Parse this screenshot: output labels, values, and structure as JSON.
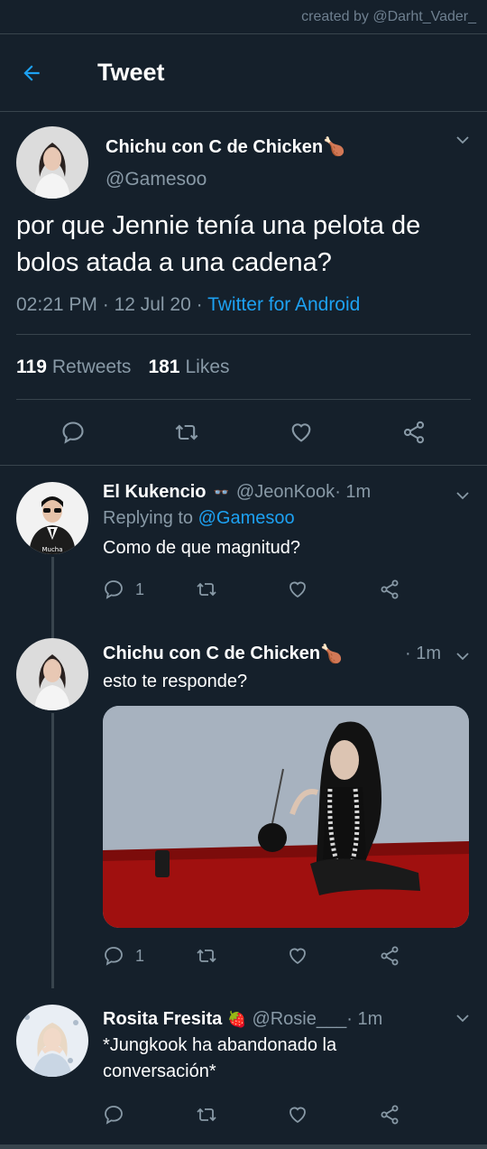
{
  "watermark": "created by @Darht_Vader_",
  "header": {
    "title": "Tweet"
  },
  "tweet": {
    "author_name": "Chichu con C de Chicken",
    "author_emoji": "🍗",
    "author_handle": "@Gamesoo",
    "text": "por que Jennie tenía una pelota de bolos atada a una cadena?",
    "time": "02:21 PM",
    "sep1": " · ",
    "date": "12 Jul 20",
    "sep2": " · ",
    "source": "Twitter for Android",
    "retweet_count": "119",
    "retweet_label": "Retweets",
    "like_count": "181",
    "like_label": "Likes"
  },
  "replies": [
    {
      "name": "El Kukencio",
      "emoji": "👓",
      "handle": "@JeonKook",
      "time": " · 1m",
      "replying_prefix": "Replying to ",
      "replying_to": "@Gamesoo",
      "text": "Como de que magnitud?",
      "reply_count": "1",
      "avatar_caption": "Mucha"
    },
    {
      "name": "Chichu con C de Chicken",
      "emoji": "🍗",
      "time": "· 1m",
      "text": "esto te responde?",
      "reply_count": "1"
    },
    {
      "name": "Rosita Fresita",
      "emoji": "🍓",
      "handle": "@Rosie___",
      "time": " · 1m",
      "text": "*Jungkook ha abandonado la conversación*"
    }
  ],
  "colors": {
    "background": "#15202b",
    "accent": "#1da1f2",
    "secondary_text": "#8899a6",
    "divider": "#38444d"
  },
  "icons": [
    "back-arrow-icon",
    "chevron-down-icon",
    "reply-icon",
    "retweet-icon",
    "like-icon",
    "share-icon"
  ]
}
